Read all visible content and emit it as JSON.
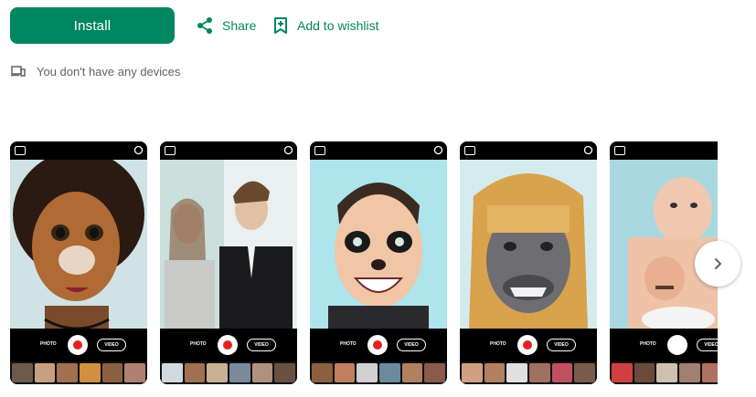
{
  "actions": {
    "install_label": "Install",
    "share_label": "Share",
    "wishlist_label": "Add to wishlist"
  },
  "devices_notice": "You don't have any devices",
  "screenshots": [
    {
      "photo_label": "PHOTO",
      "video_label": "VIDEO"
    },
    {
      "photo_label": "PHOTO",
      "video_label": "VIDEO"
    },
    {
      "photo_label": "PHOTO",
      "video_label": "VIDEO"
    },
    {
      "photo_label": "PHOTO",
      "video_label": "VIDEO"
    },
    {
      "photo_label": "PHOTO",
      "video_label": "VIDEO"
    }
  ],
  "colors": {
    "accent": "#01875f",
    "muted_text": "#5f6368",
    "record": "#e62020"
  },
  "icons": {
    "share": "share-icon",
    "wishlist": "bookmark-add-icon",
    "devices": "devices-icon",
    "next": "chevron-right-icon"
  }
}
